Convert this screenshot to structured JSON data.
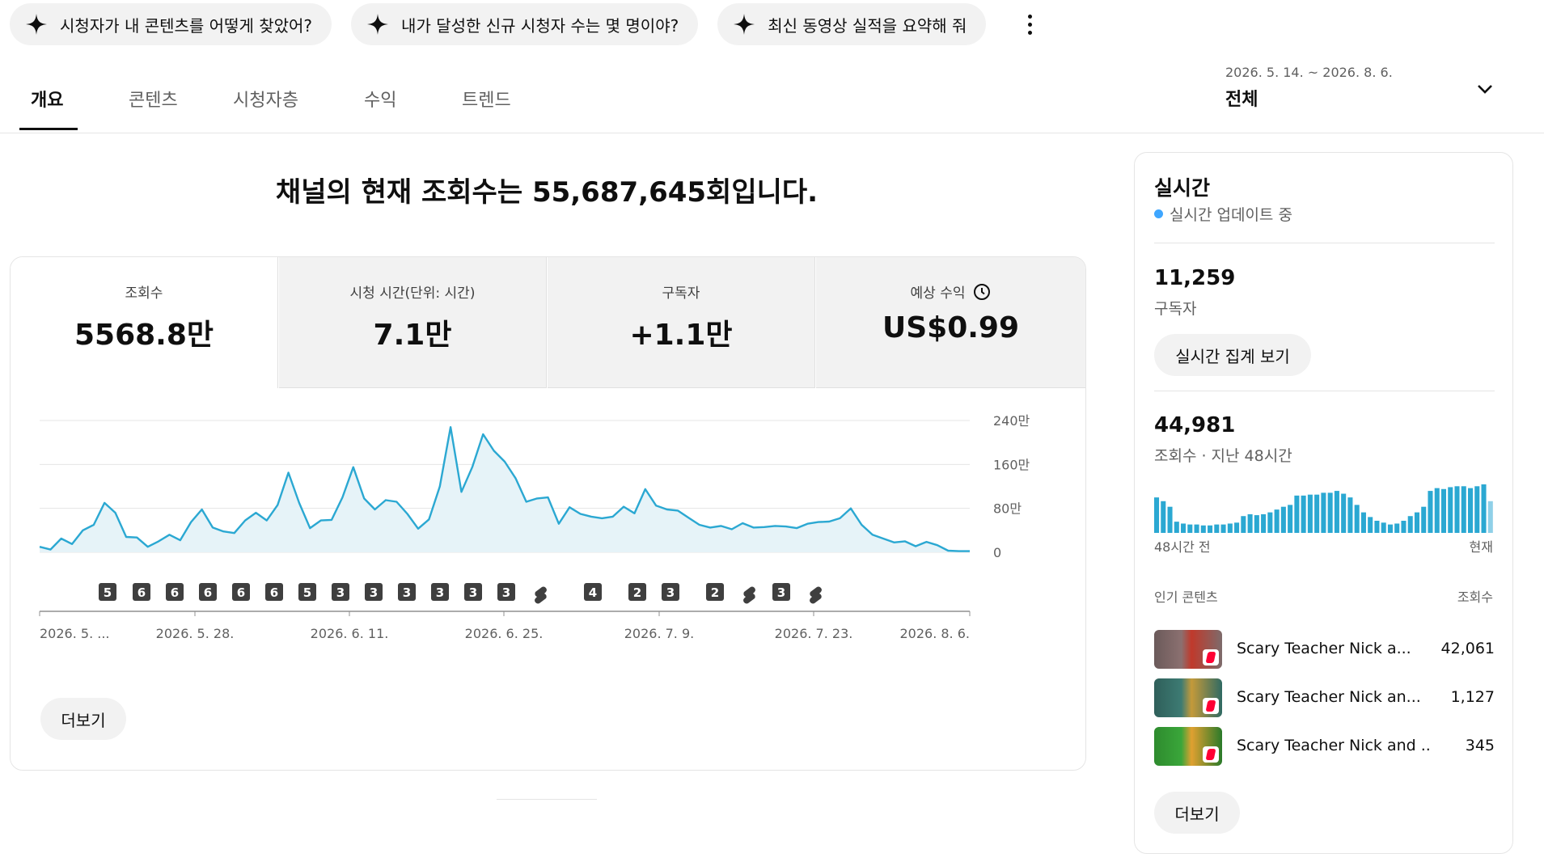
{
  "chips": [
    {
      "label": "시청자가 내 콘텐츠를 어떻게 찾았어?"
    },
    {
      "label": "내가 달성한 신규 시청자 수는 몇 명이야?"
    },
    {
      "label": "최신 동영상 실적을 요약해 줘"
    }
  ],
  "tabs": [
    {
      "label": "개요",
      "active": true
    },
    {
      "label": "콘텐츠"
    },
    {
      "label": "시청자층"
    },
    {
      "label": "수익"
    },
    {
      "label": "트렌드"
    }
  ],
  "period": {
    "range": "2026. 5. 14. ~ 2026. 8. 6.",
    "label": "전체"
  },
  "headline": "채널의 현재 조회수는 55,687,645회입니다.",
  "metrics": [
    {
      "label": "조회수",
      "value": "5568.8만"
    },
    {
      "label": "시청 시간(단위: 시간)",
      "value": "7.1만"
    },
    {
      "label": "구독자",
      "value": "+1.1만"
    },
    {
      "label": "예상 수익",
      "value": "US$0.99"
    }
  ],
  "chart_data": {
    "type": "area",
    "y_tick_labels": [
      "240만",
      "160만",
      "80만",
      "0"
    ],
    "ylim": [
      0,
      2400000
    ],
    "x_tick_labels": [
      "2026. 5. ...",
      "2026. 5. 28.",
      "2026. 6. 11.",
      "2026. 6. 25.",
      "2026. 7. 9.",
      "2026. 7. 23.",
      "2026. 8. 6."
    ],
    "series": [
      {
        "values": [
          100000,
          50000,
          250000,
          150000,
          400000,
          500000,
          900000,
          720000,
          280000,
          270000,
          100000,
          200000,
          320000,
          220000,
          550000,
          780000,
          450000,
          380000,
          350000,
          580000,
          720000,
          580000,
          860000,
          1450000,
          900000,
          440000,
          580000,
          590000,
          1000000,
          1550000,
          980000,
          780000,
          950000,
          920000,
          700000,
          430000,
          600000,
          1200000,
          2280000,
          1100000,
          1550000,
          2150000,
          1850000,
          1650000,
          1350000,
          920000,
          980000,
          1000000,
          520000,
          820000,
          700000,
          650000,
          620000,
          650000,
          830000,
          710000,
          1150000,
          850000,
          780000,
          760000,
          630000,
          500000,
          450000,
          480000,
          420000,
          530000,
          450000,
          460000,
          480000,
          470000,
          440000,
          520000,
          550000,
          560000,
          620000,
          800000,
          500000,
          320000,
          250000,
          180000,
          200000,
          110000,
          190000,
          130000,
          30000,
          20000,
          20000
        ]
      }
    ],
    "color": "#2ba8d2",
    "fill": "#e6f3f8",
    "markers": [
      {
        "label": "5",
        "type": "count"
      },
      {
        "label": "6",
        "type": "count"
      },
      {
        "label": "6",
        "type": "count"
      },
      {
        "label": "6",
        "type": "count"
      },
      {
        "label": "6",
        "type": "count"
      },
      {
        "label": "6",
        "type": "count"
      },
      {
        "label": "5",
        "type": "count"
      },
      {
        "label": "3",
        "type": "count"
      },
      {
        "label": "3",
        "type": "count"
      },
      {
        "label": "3",
        "type": "count"
      },
      {
        "label": "3",
        "type": "count"
      },
      {
        "label": "3",
        "type": "count"
      },
      {
        "label": "3",
        "type": "count"
      },
      {
        "label": "",
        "type": "shorts"
      },
      {
        "label": "4",
        "type": "count"
      },
      {
        "label": "2",
        "type": "count"
      },
      {
        "label": "3",
        "type": "count"
      },
      {
        "label": "2",
        "type": "count"
      },
      {
        "label": "",
        "type": "shorts"
      },
      {
        "label": "3",
        "type": "count"
      },
      {
        "label": "",
        "type": "shorts"
      }
    ]
  },
  "more_button_label": "더보기",
  "realtime": {
    "title": "실시간",
    "status": "실시간 업데이트 중",
    "subscribers_value": "11,259",
    "subscribers_label": "구독자",
    "live_count_button": "실시간 집계 보기",
    "views_value": "44,981",
    "views_label": "조회수 · 지난 48시간",
    "bars_start_label": "48시간 전",
    "bars_end_label": "현재",
    "bars": [
      38,
      34,
      28,
      12,
      10,
      9,
      9,
      8,
      8,
      9,
      9,
      10,
      11,
      18,
      20,
      19,
      20,
      22,
      25,
      28,
      30,
      40,
      40,
      41,
      41,
      43,
      43,
      45,
      42,
      38,
      30,
      22,
      17,
      13,
      11,
      9,
      10,
      13,
      18,
      22,
      28,
      45,
      48,
      47,
      49,
      50,
      50,
      48,
      50,
      52,
      34
    ],
    "top_content_header": "인기 콘텐츠",
    "top_content_metric": "조회수",
    "top_content": [
      {
        "title": "Scary Teacher Nick a...",
        "views": "42,061"
      },
      {
        "title": "Scary Teacher Nick an...",
        "views": "1,127"
      },
      {
        "title": "Scary Teacher Nick and ...",
        "views": "345"
      }
    ],
    "more_label": "더보기"
  }
}
